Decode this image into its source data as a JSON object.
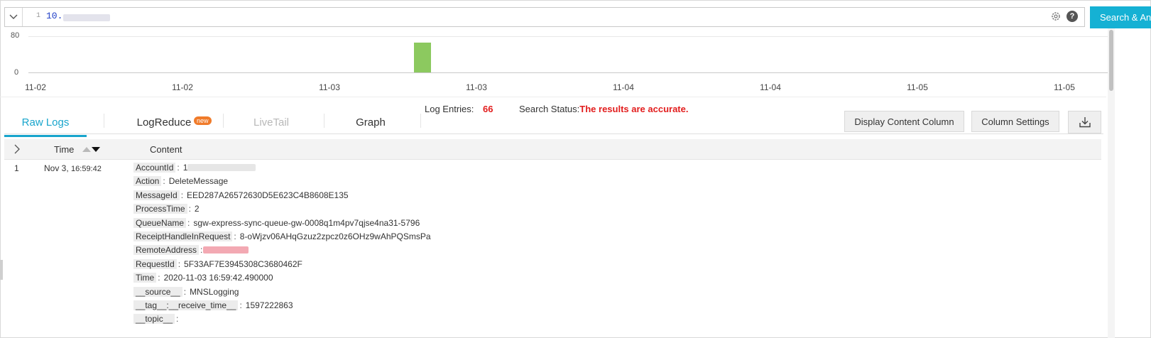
{
  "query": {
    "line_number": "1",
    "text": "10."
  },
  "search_button": {
    "label": "Search & Analyze"
  },
  "histogram": {
    "y_ticks": [
      "80",
      "0"
    ],
    "x_ticks": [
      "11-02",
      "11-02",
      "11-03",
      "11-03",
      "11-04",
      "11-04",
      "11-05",
      "11-05"
    ],
    "bar_value": 66,
    "bar_color": "#8cc95f"
  },
  "summary": {
    "log_entries_label": "Log Entries:",
    "log_entries_value": "66",
    "search_status_label": "Search Status:",
    "search_status_value": "The results are accurate."
  },
  "tabs": [
    {
      "label": "Raw Logs",
      "state": "active"
    },
    {
      "label": "LogReduce",
      "state": "normal",
      "badge": "new"
    },
    {
      "label": "LiveTail",
      "state": "disabled"
    },
    {
      "label": "Graph",
      "state": "normal"
    }
  ],
  "toolbar": {
    "display_content_column": "Display Content Column",
    "column_settings": "Column Settings"
  },
  "table": {
    "columns": [
      "Time",
      "Content"
    ],
    "rows": [
      {
        "index": "1",
        "time_date": "Nov 3,",
        "time_clock": "16:59:42",
        "fields": [
          {
            "key": "AccountId",
            "value": "1"
          },
          {
            "key": "Action",
            "value": "DeleteMessage"
          },
          {
            "key": "MessageId",
            "value": "EED287A26572630D5E623C4B8608E135"
          },
          {
            "key": "ProcessTime",
            "value": "2"
          },
          {
            "key": "QueueName",
            "value": "sgw-express-sync-queue-gw-0008q1m4pv7qjse4na31-5796"
          },
          {
            "key": "ReceiptHandleInRequest",
            "value": "8-oWjzv06AHqGzuz2zpcz0z6OHz9wAhPQSmsPa"
          },
          {
            "key": "RemoteAddress",
            "value": ""
          },
          {
            "key": "RequestId",
            "value": "5F33AF7E3945308C3680462F"
          },
          {
            "key": "Time",
            "value": "2020-11-03 16:59:42.490000"
          },
          {
            "key": "__source__",
            "value": "MNSLogging"
          },
          {
            "key": "__tag__:__receive_time__",
            "value": "1597222863"
          },
          {
            "key": "__topic__",
            "value": ""
          }
        ]
      }
    ]
  },
  "colors": {
    "accent": "#18a5cc",
    "search_button": "#15b1d4",
    "alert": "#e21d1d",
    "badge": "#f07b2a"
  }
}
